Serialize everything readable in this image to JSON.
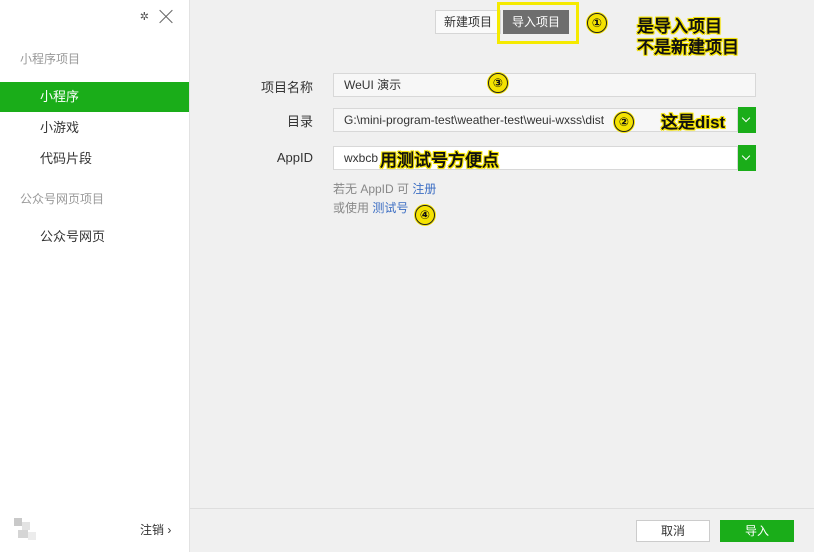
{
  "sidebar": {
    "groups": [
      {
        "title": "小程序项目",
        "items": [
          "小程序",
          "小游戏",
          "代码片段"
        ]
      },
      {
        "title": "公众号网页项目",
        "items": [
          "公众号网页"
        ]
      }
    ],
    "active_item": "小程序",
    "settings_icon": "gear-icon",
    "close_icon": "close-icon",
    "logout_label": "注销 ›"
  },
  "header": {
    "tab_new": "新建项目",
    "tab_import": "导入项目"
  },
  "form": {
    "project_name": {
      "label": "项目名称",
      "value": "WeUI 演示"
    },
    "directory": {
      "label": "目录",
      "value": "G:\\mini-program-test\\weather-test\\weui-wxss\\dist"
    },
    "appid": {
      "label": "AppID",
      "value": "wxbcb"
    },
    "hint_line1_prefix": "若无 AppID 可",
    "hint_line1_link": "注册",
    "hint_line2_prefix": "或使用",
    "hint_line2_link": "测试号"
  },
  "annotations": {
    "badge1": "①",
    "badge2": "②",
    "badge3": "③",
    "badge4": "④",
    "note_import_line1": "是导入项目",
    "note_import_line2": "不是新建项目",
    "note_dist": "这是dist",
    "note_testid": "用测试号方便点",
    "highlight_color": "#f5ea00"
  },
  "footer": {
    "cancel_label": "取消",
    "import_label": "导入"
  },
  "colors": {
    "accent": "#1aad19",
    "active_tab": "#6e6e6e",
    "link": "#3c6ec3"
  }
}
